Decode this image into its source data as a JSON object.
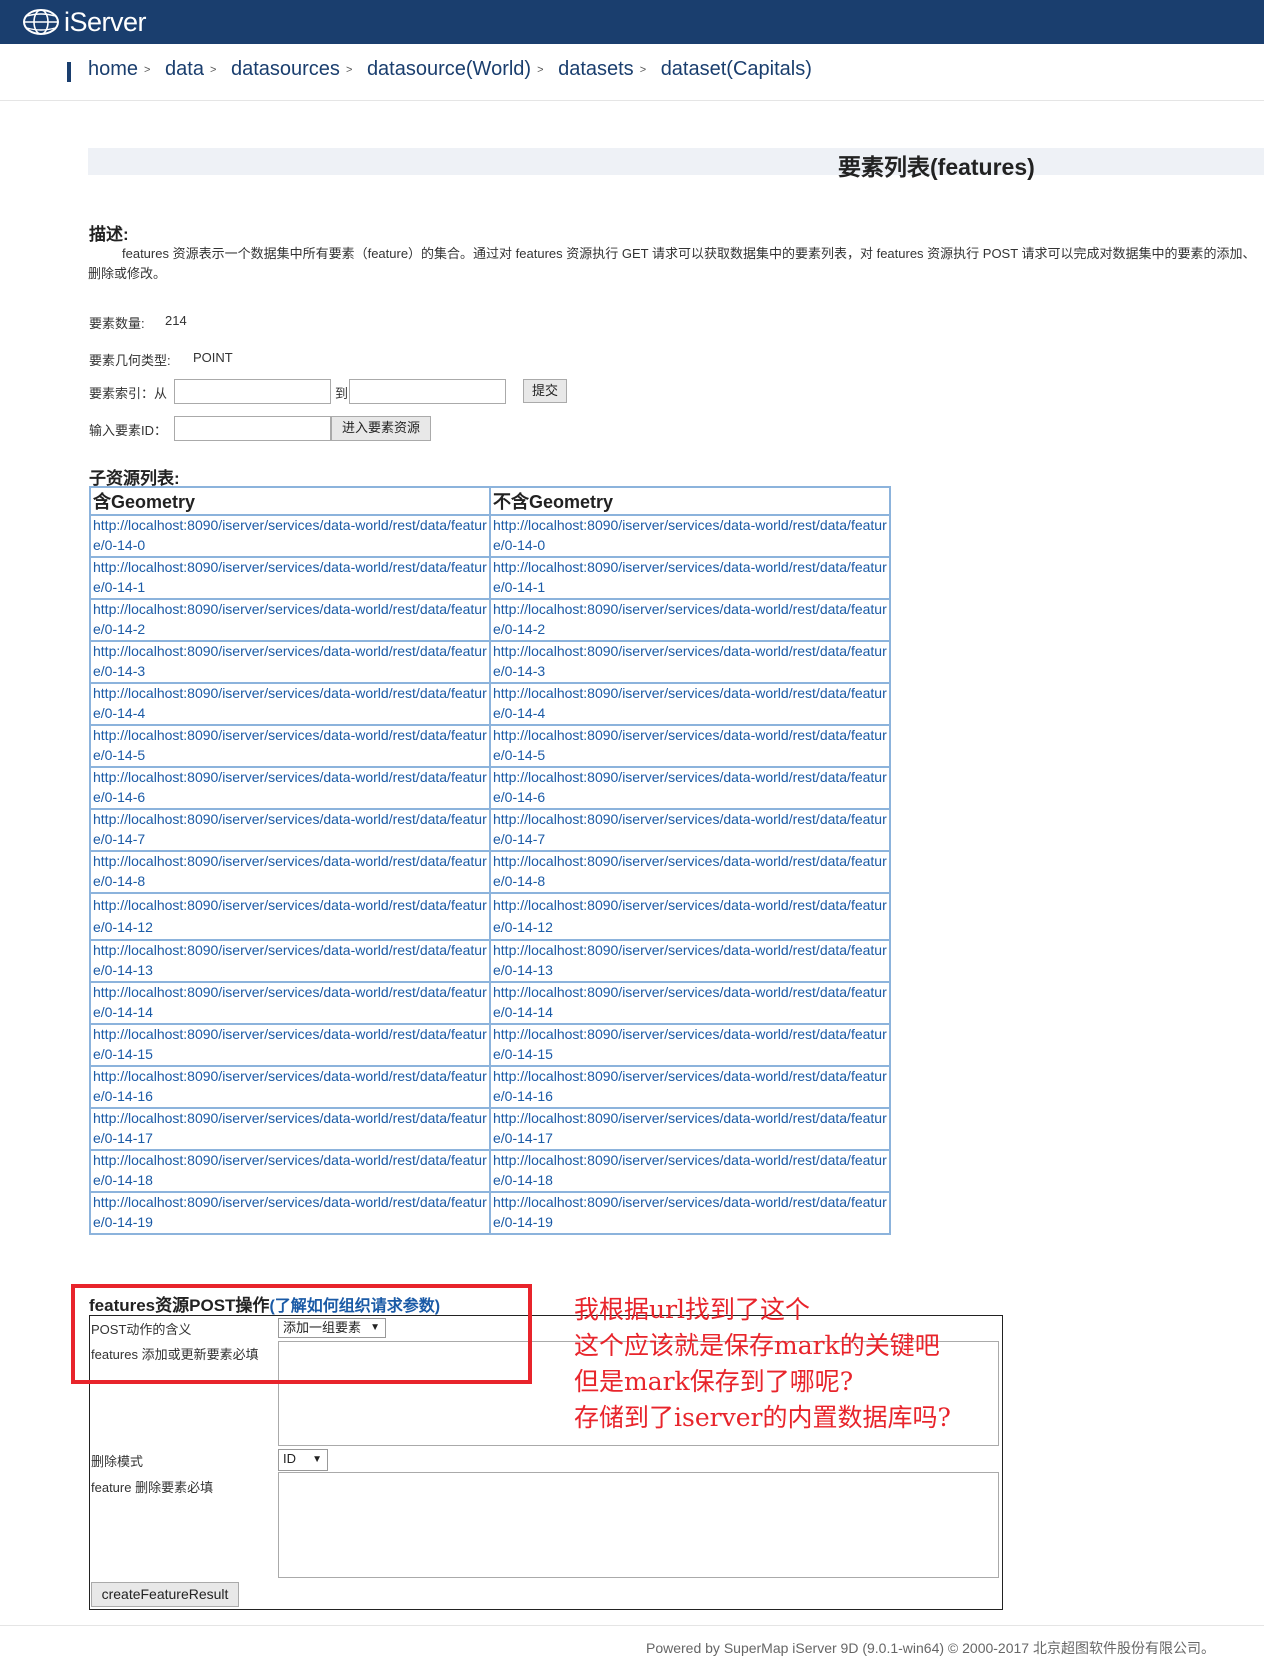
{
  "header": {
    "logo_text": "iServer",
    "logo_icon": "globe-icon"
  },
  "breadcrumb": [
    {
      "label": "home"
    },
    {
      "label": "data"
    },
    {
      "label": "datasources"
    },
    {
      "label": "datasource(World)"
    },
    {
      "label": "datasets"
    },
    {
      "label": "dataset(Capitals)"
    }
  ],
  "page": {
    "title": "要素列表(features)",
    "desc_heading": "描述:",
    "description": "features 资源表示一个数据集中所有要素（feature）的集合。通过对 features 资源执行 GET 请求可以获取数据集中的要素列表，对 features 资源执行 POST 请求可以完成对数据集中的要素的添加、删除或修改。",
    "count_label": "要素数量:",
    "count_value": "214",
    "geom_label": "要素几何类型:",
    "geom_value": "POINT",
    "index_label": "要素索引：从",
    "index_to": "到",
    "submit_label": "提交",
    "id_label": "输入要素ID：",
    "enter_label": "进入要素资源"
  },
  "subresources": {
    "heading": "子资源列表:",
    "col_with": "含Geometry",
    "col_without": "不含Geometry",
    "rows": [
      {
        "with": "http://localhost:8090/iserver/services/data-world/rest/data/feature/0-14-0",
        "without": "http://localhost:8090/iserver/services/data-world/rest/data/feature/0-14-0"
      },
      {
        "with": "http://localhost:8090/iserver/services/data-world/rest/data/feature/0-14-1",
        "without": "http://localhost:8090/iserver/services/data-world/rest/data/feature/0-14-1"
      },
      {
        "with": "http://localhost:8090/iserver/services/data-world/rest/data/feature/0-14-2",
        "without": "http://localhost:8090/iserver/services/data-world/rest/data/feature/0-14-2"
      },
      {
        "with": "http://localhost:8090/iserver/services/data-world/rest/data/feature/0-14-3",
        "without": "http://localhost:8090/iserver/services/data-world/rest/data/feature/0-14-3"
      },
      {
        "with": "http://localhost:8090/iserver/services/data-world/rest/data/feature/0-14-4",
        "without": "http://localhost:8090/iserver/services/data-world/rest/data/feature/0-14-4"
      },
      {
        "with": "http://localhost:8090/iserver/services/data-world/rest/data/feature/0-14-5",
        "without": "http://localhost:8090/iserver/services/data-world/rest/data/feature/0-14-5"
      },
      {
        "with": "http://localhost:8090/iserver/services/data-world/rest/data/feature/0-14-6",
        "without": "http://localhost:8090/iserver/services/data-world/rest/data/feature/0-14-6"
      },
      {
        "with": "http://localhost:8090/iserver/services/data-world/rest/data/feature/0-14-7",
        "without": "http://localhost:8090/iserver/services/data-world/rest/data/feature/0-14-7"
      },
      {
        "with": "http://localhost:8090/iserver/services/data-world/rest/data/feature/0-14-8",
        "without": "http://localhost:8090/iserver/services/data-world/rest/data/feature/0-14-8"
      },
      {
        "with": "http://localhost:8090/iserver/services/data-world/rest/data/feature/0-14-12",
        "without": "http://localhost:8090/iserver/services/data-world/rest/data/feature/0-14-12"
      },
      {
        "with": "http://localhost:8090/iserver/services/data-world/rest/data/feature/0-14-13",
        "without": "http://localhost:8090/iserver/services/data-world/rest/data/feature/0-14-13"
      },
      {
        "with": "http://localhost:8090/iserver/services/data-world/rest/data/feature/0-14-14",
        "without": "http://localhost:8090/iserver/services/data-world/rest/data/feature/0-14-14"
      },
      {
        "with": "http://localhost:8090/iserver/services/data-world/rest/data/feature/0-14-15",
        "without": "http://localhost:8090/iserver/services/data-world/rest/data/feature/0-14-15"
      },
      {
        "with": "http://localhost:8090/iserver/services/data-world/rest/data/feature/0-14-16",
        "without": "http://localhost:8090/iserver/services/data-world/rest/data/feature/0-14-16"
      },
      {
        "with": "http://localhost:8090/iserver/services/data-world/rest/data/feature/0-14-17",
        "without": "http://localhost:8090/iserver/services/data-world/rest/data/feature/0-14-17"
      },
      {
        "with": "http://localhost:8090/iserver/services/data-world/rest/data/feature/0-14-18",
        "without": "http://localhost:8090/iserver/services/data-world/rest/data/feature/0-14-18"
      },
      {
        "with": "http://localhost:8090/iserver/services/data-world/rest/data/feature/0-14-19",
        "without": "http://localhost:8090/iserver/services/data-world/rest/data/feature/0-14-19"
      }
    ]
  },
  "post": {
    "heading": "features资源POST操作",
    "help_link": "(了解如何组织请求参数)",
    "action_label": "POST动作的含义",
    "action_value": "添加一组要素",
    "features_label": "features 添加或更新要素必填",
    "delete_mode_label": "删除模式",
    "delete_mode_value": "ID",
    "feature_delete_label": "feature 删除要素必填",
    "submit_label": "createFeatureResult"
  },
  "annotation": {
    "color": "#e8242b",
    "lines": [
      "我根据url找到了这个",
      "这个应该就是保存mark的关键吧",
      "但是mark保存到了哪呢?",
      "存储到了iserver的内置数据库吗?"
    ]
  },
  "footer": {
    "text": "Powered by SuperMap iServer 9D (9.0.1-win64) © 2000-2017 北京超图软件股份有限公司。"
  },
  "colors": {
    "header_bg": "#1a3e6e",
    "link": "#1a5aa6",
    "table_border": "#8cb3dc"
  }
}
